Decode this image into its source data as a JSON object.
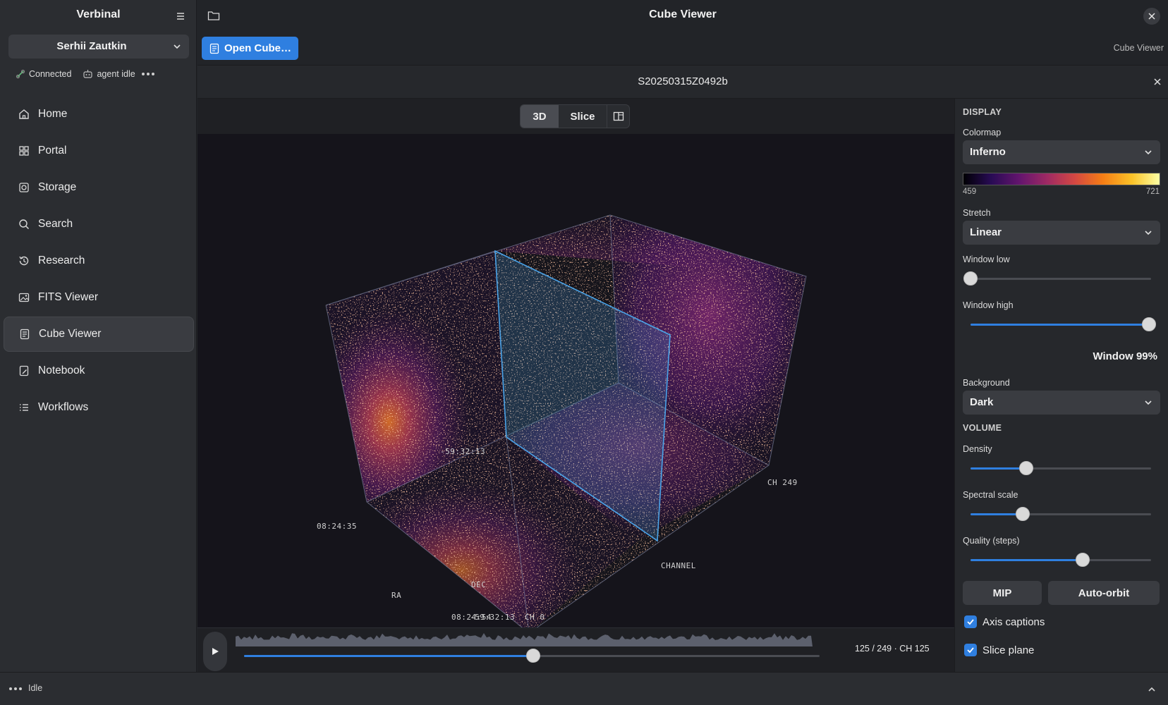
{
  "sidebar": {
    "brand": "Verbinal",
    "user": "Serhii Zautkin",
    "status": {
      "connection": "Connected",
      "agent": "agent idle"
    },
    "items": [
      {
        "label": "Home",
        "icon": "home-icon"
      },
      {
        "label": "Portal",
        "icon": "grid-icon"
      },
      {
        "label": "Storage",
        "icon": "storage-icon"
      },
      {
        "label": "Search",
        "icon": "search-icon"
      },
      {
        "label": "Research",
        "icon": "history-icon"
      },
      {
        "label": "FITS Viewer",
        "icon": "image-icon"
      },
      {
        "label": "Cube Viewer",
        "icon": "cube-doc-icon",
        "active": true
      },
      {
        "label": "Notebook",
        "icon": "notebook-icon"
      },
      {
        "label": "Workflows",
        "icon": "list-icon"
      }
    ]
  },
  "topbar": {
    "title": "Cube Viewer",
    "open_button": "Open Cube…",
    "breadcrumb": "Cube Viewer"
  },
  "document": {
    "title": "S20250315Z0492b"
  },
  "view_modes": {
    "mode_3d": "3D",
    "mode_slice": "Slice",
    "active": "3D"
  },
  "scene": {
    "labels": {
      "dec_value": "-59:32:13",
      "ra_value": "08:24:35",
      "ch_end": "CH 249",
      "channel": "CHANNEL",
      "ra": "RA",
      "dec": "DEC",
      "bottom_overlap_a": "08:24:54",
      "bottom_overlap_b": "-59:32:13",
      "ch_start": "CH 0"
    }
  },
  "timeline": {
    "readout": "125 / 249 · CH 125",
    "current": 125,
    "max": 249
  },
  "panel": {
    "display_title": "DISPLAY",
    "colormap_label": "Colormap",
    "colormap": "Inferno",
    "range_min": "459",
    "range_max": "721",
    "stretch_label": "Stretch",
    "stretch": "Linear",
    "window_low_label": "Window low",
    "window_low": 0.0,
    "window_high_label": "Window high",
    "window_high": 0.99,
    "window_text": "Window 99%",
    "background_label": "Background",
    "background": "Dark",
    "volume_title": "VOLUME",
    "density_label": "Density",
    "density": 0.31,
    "spectral_label": "Spectral scale",
    "spectral": 0.29,
    "quality_label": "Quality (steps)",
    "quality": 0.62,
    "mip_button": "MIP",
    "autoorbit_button": "Auto-orbit",
    "axis_captions": "Axis captions",
    "slice_plane": "Slice plane"
  },
  "statusbar": {
    "text": "Idle"
  },
  "colors": {
    "accent": "#2f7fe0",
    "slice": "#4aa3e8"
  }
}
